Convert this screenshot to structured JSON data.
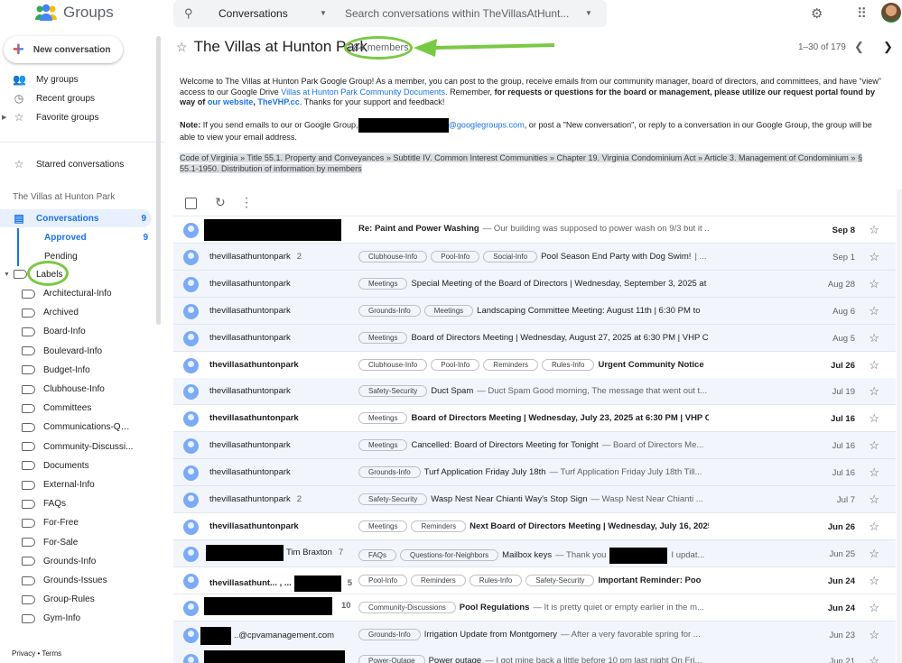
{
  "app": {
    "name": "Groups"
  },
  "sidebar": {
    "new_conversation": "New conversation",
    "nav": [
      {
        "label": "My groups",
        "icon": "people-icon"
      },
      {
        "label": "Recent groups",
        "icon": "clock-icon"
      },
      {
        "label": "Favorite groups",
        "icon": "star-icon"
      }
    ],
    "starred": "Starred conversations",
    "group_name": "The Villas at Hunton Park",
    "conversations": {
      "label": "Conversations",
      "count": "9"
    },
    "approved": {
      "label": "Approved",
      "count": "9"
    },
    "pending": "Pending",
    "labels_heading": "Labels",
    "labels": [
      "Architectural-Info",
      "Archived",
      "Board-Info",
      "Boulevard-Info",
      "Budget-Info",
      "Clubhouse-Info",
      "Committees",
      "Communications-Que...",
      "Community-Discussi...",
      "Documents",
      "External-Info",
      "FAQs",
      "For-Free",
      "For-Sale",
      "Grounds-Info",
      "Grounds-Issues",
      "Group-Rules",
      "Gym-Info"
    ],
    "footer_privacy": "Privacy",
    "footer_sep": " • ",
    "footer_terms": "Terms"
  },
  "topbar": {
    "scope": "Conversations",
    "search_placeholder": "Search conversations within TheVillasAtHunt..."
  },
  "header": {
    "title": "The Villas at Hunton Park",
    "members": "284 members",
    "pager": "1–30 of 179"
  },
  "description": {
    "p1_a": "Welcome to The Villas at Hunton Park Google Group! As a member, you can post to the group, receive emails from our community manager, board of directors, and committees, and have “view” access to our Google Drive ",
    "p1_link": "Villas at Hunton Park Community Documents",
    "p1_b": ". Remember, ",
    "p1_bold": "for requests or questions for the board or management, please utilize our request portal found by way of ",
    "p1_site": "our website",
    "p1_c": ", ",
    "p1_vhp": "TheVHP.cc",
    "p1_d": ". Thanks for your support and feedback!",
    "p2_note": "Note:",
    "p2_a": " If you send emails to our or Google Group,",
    "p2_domain": "@googlegroups.com",
    "p2_b": ", or post a \"New conversation\", or reply to a conversation in our Google Group, the group will be able to view your email address.",
    "p3": "Code of Virginia » Title 55.1. Property and Conveyances » Subtitle IV. Common Interest Communities » Chapter 19. Virginia Condominium Act » Article 3. Management of Condominium » § 55.1-1950. Distribution of information by members"
  },
  "conversations": [
    {
      "sender": "",
      "count": "",
      "unread": true,
      "labels": [],
      "subject": "Re: Paint and Power Washing",
      "snippet": " — Our building was supposed to power wash on 9/3 but it ...",
      "date": "Sep 8"
    },
    {
      "sender": "thevillasathuntonpark",
      "count": "2",
      "unread": false,
      "labels": [
        "Clubhouse-Info",
        "Pool-Info",
        "Social-Info"
      ],
      "subject": "Pool Season End Party with Dog Swim!",
      "snippet": " | ...",
      "date": "Sep 1"
    },
    {
      "sender": "thevillasathuntonpark",
      "count": "",
      "unread": false,
      "labels": [
        "Meetings"
      ],
      "subject": "Special Meeting of the Board of Directors | Wednesday, September 3, 2025 at",
      "snippet": "",
      "date": "Aug 28"
    },
    {
      "sender": "thevillasathuntonpark",
      "count": "",
      "unread": false,
      "labels": [
        "Grounds-Info",
        "Meetings"
      ],
      "subject": "Landscaping Committee Meeting: August 11th | 6:30 PM to",
      "snippet": "",
      "date": "Aug 6"
    },
    {
      "sender": "thevillasathuntonpark",
      "count": "",
      "unread": false,
      "labels": [
        "Meetings"
      ],
      "subject": "Board of Directors Meeting | Wednesday, August 27, 2025 at 6:30 PM | VHP C",
      "snippet": "",
      "date": "Aug 5"
    },
    {
      "sender": "thevillasathuntonpark",
      "count": "",
      "unread": true,
      "labels": [
        "Clubhouse-Info",
        "Pool-Info",
        "Reminders",
        "Rules-Info"
      ],
      "subject": "Urgent Community Notice",
      "snippet": "",
      "date": "Jul 26"
    },
    {
      "sender": "thevillasathuntonpark",
      "count": "",
      "unread": false,
      "labels": [
        "Safety-Security"
      ],
      "subject": "Duct Spam",
      "snippet": " — Duct Spam Good morning, The message that went out t...",
      "date": "Jul 19"
    },
    {
      "sender": "thevillasathuntonpark",
      "count": "",
      "unread": true,
      "labels": [
        "Meetings"
      ],
      "subject": "Board of Directors Meeting | Wednesday, July 23, 2025 at 6:30 PM | VHP Clu",
      "snippet": "",
      "date": "Jul 16"
    },
    {
      "sender": "thevillasathuntonpark",
      "count": "",
      "unread": false,
      "labels": [
        "Meetings"
      ],
      "subject": "Cancelled: Board of Directors Meeting for Tonight",
      "snippet": " — Board of Directors Me...",
      "date": "Jul 16"
    },
    {
      "sender": "thevillasathuntonpark",
      "count": "",
      "unread": false,
      "labels": [
        "Grounds-Info"
      ],
      "subject": "Turf Application Friday July 18th",
      "snippet": " — Turf Application Friday July 18th Till...",
      "date": "Jul 16"
    },
    {
      "sender": "thevillasathuntonpark",
      "count": "2",
      "unread": false,
      "labels": [
        "Safety-Security"
      ],
      "subject": "Wasp Nest Near Chianti Way's Stop Sign",
      "snippet": " — Wasp Nest Near Chianti ...",
      "date": "Jul 7"
    },
    {
      "sender": "thevillasathuntonpark",
      "count": "",
      "unread": true,
      "labels": [
        "Meetings",
        "Reminders"
      ],
      "subject": "Next Board of Directors Meeting | Wednesday, July 16, 2025",
      "snippet": "",
      "date": "Jun 26"
    },
    {
      "sender": "Tim Braxton",
      "count": "7",
      "unread": false,
      "labels": [
        "FAQs",
        "Questions-for-Neighbors"
      ],
      "subject": "Mailbox keys",
      "snippet": " — Thank you",
      "snippet2": " I updat...",
      "date": "Jun 25"
    },
    {
      "sender": "thevillasathunt... , ...",
      "count": "5",
      "unread": true,
      "labels": [
        "Pool-Info",
        "Reminders",
        "Rules-Info",
        "Safety-Security"
      ],
      "subject": "Important Reminder: Poo",
      "snippet": "",
      "date": "Jun 24"
    },
    {
      "sender": "",
      "count": "10",
      "unread": true,
      "labels": [
        "Community-Discussions"
      ],
      "subject": "Pool Regulations",
      "snippet": " — It is pretty quiet or empty earlier in the m...",
      "date": "Jun 24"
    },
    {
      "sender": "..@cpvamanagement.com",
      "count": "",
      "unread": false,
      "labels": [
        "Grounds-Info"
      ],
      "subject": "Irrigation Update from Montgomery",
      "snippet": " — After a very favorable spring for ...",
      "date": "Jun 23"
    },
    {
      "sender": "",
      "count": "",
      "unread": false,
      "labels": [
        "Power-Outage"
      ],
      "subject": "Power outage",
      "snippet": " — I got mine back a little before 10 pm last night On Fri...",
      "date": "Jun 21"
    }
  ]
}
